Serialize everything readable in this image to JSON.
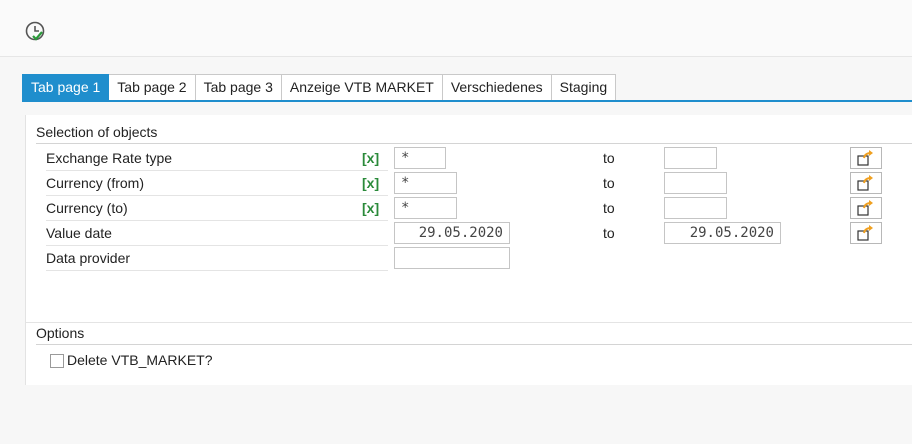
{
  "toolbar": {
    "execute_icon": "clock-execute-icon"
  },
  "tabs": [
    {
      "label": "Tab page 1",
      "active": true
    },
    {
      "label": "Tab page 2"
    },
    {
      "label": "Tab page 3"
    },
    {
      "label": "Anzeige VTB MARKET"
    },
    {
      "label": "Verschiedenes"
    },
    {
      "label": "Staging"
    }
  ],
  "selection": {
    "title": "Selection of objects",
    "rows": [
      {
        "label": "Exchange Rate type",
        "matchcode": "[x]",
        "from": "*",
        "to_label": "to",
        "to": ""
      },
      {
        "label": "Currency (from)",
        "matchcode": "[x]",
        "from": "*",
        "to_label": "to",
        "to": ""
      },
      {
        "label": "Currency (to)",
        "matchcode": "[x]",
        "from": "*",
        "to_label": "to",
        "to": ""
      },
      {
        "label": "Value date",
        "from": "29.05.2020",
        "to_label": "to",
        "to": "29.05.2020"
      },
      {
        "label": "Data provider",
        "from": ""
      }
    ]
  },
  "options": {
    "title": "Options",
    "delete_label": "Delete VTB_MARKET?",
    "delete_checked": false
  },
  "colors": {
    "accent": "#1f8ecd",
    "matchcode_green": "#2a8a3a",
    "arrow_orange": "#f0a020"
  }
}
